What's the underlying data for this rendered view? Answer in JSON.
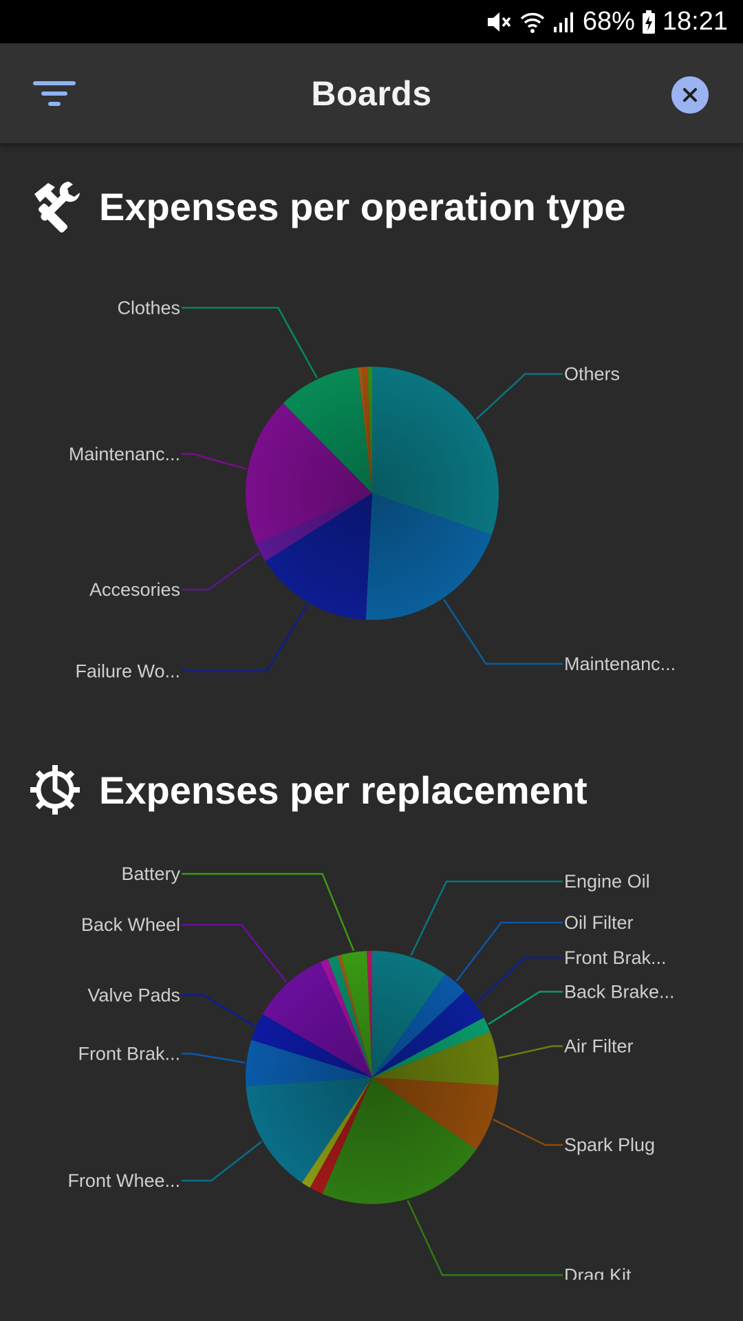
{
  "status_bar": {
    "battery": "68%",
    "time": "18:21"
  },
  "app_bar": {
    "title": "Boards",
    "left_icon": "filter-icon",
    "right_icon": "close-icon",
    "accent": "#9ab4f2"
  },
  "sections": [
    {
      "title": "Expenses per operation type",
      "icon": "tools-icon"
    },
    {
      "title": "Expenses per replacement",
      "icon": "gear-icon"
    }
  ],
  "chart_data": [
    {
      "type": "pie",
      "title": "Expenses per operation type",
      "slices": [
        {
          "label": "Others",
          "value": 30.3,
          "color": "#0a7580",
          "side": "right",
          "show_label": true
        },
        {
          "label": "Maintenanc...",
          "value": 20.5,
          "color": "#0a5f9c",
          "side": "right",
          "show_label": true
        },
        {
          "label": "Failure Wo...",
          "value": 15.2,
          "color": "#0d1c90",
          "side": "left",
          "show_label": true
        },
        {
          "label": "Accesories",
          "value": 2.5,
          "color": "#5a1890",
          "side": "left",
          "show_label": true
        },
        {
          "label": "Maintenanc...",
          "value": 19.1,
          "color": "#7a0e8c",
          "side": "left",
          "show_label": true
        },
        {
          "label": "Clothes",
          "value": 10.6,
          "color": "#078a56",
          "side": "left",
          "show_label": true
        },
        {
          "label": "",
          "value": 0.5,
          "color": "#9a5a12",
          "side": "left",
          "show_label": false
        },
        {
          "label": "",
          "value": 0.7,
          "color": "#a24a10",
          "side": "left",
          "show_label": false
        },
        {
          "label": "",
          "value": 0.6,
          "color": "#3a8a12",
          "side": "left",
          "show_label": false
        }
      ]
    },
    {
      "type": "pie",
      "title": "Expenses per replacement",
      "slices": [
        {
          "label": "Engine Oil",
          "value": 10.0,
          "color": "#0a7580",
          "side": "right",
          "show_label": true
        },
        {
          "label": "Oil Filter",
          "value": 3.3,
          "color": "#0a58a8",
          "side": "right",
          "show_label": true
        },
        {
          "label": "Front Brak...",
          "value": 4.2,
          "color": "#0b1f9a",
          "side": "right",
          "side_note": "",
          "show_label": true
        },
        {
          "label": "Back Brake...",
          "value": 2.0,
          "color": "#0a9a6a",
          "side": "right",
          "show_label": true
        },
        {
          "label": "Air Filter",
          "value": 7.0,
          "color": "#6a7e0c",
          "side": "right",
          "show_label": true
        },
        {
          "label": "Spark Plug",
          "value": 8.8,
          "color": "#8e4a0a",
          "side": "right",
          "show_label": true
        },
        {
          "label": "Drag Kit",
          "value": 22.2,
          "color": "#2f7a12",
          "side": "right",
          "show_label": true
        },
        {
          "label": "",
          "value": 1.8,
          "color": "#a01818",
          "side": "left",
          "show_label": false
        },
        {
          "label": "",
          "value": 1.2,
          "color": "#8a9a12",
          "side": "left",
          "show_label": false
        },
        {
          "label": "Front Whee...",
          "value": 14.8,
          "color": "#0a6e88",
          "side": "left",
          "show_label": true
        },
        {
          "label": "Front Brak...",
          "value": 6.0,
          "color": "#0a5aa8",
          "side": "left",
          "show_label": true
        },
        {
          "label": "Valve Pads",
          "value": 3.6,
          "color": "#0d1aa0",
          "side": "left",
          "show_label": true
        },
        {
          "label": "Back Wheel",
          "value": 10.2,
          "color": "#6a0e9c",
          "side": "left",
          "show_label": true
        },
        {
          "label": "",
          "value": 1.0,
          "color": "#a0129a",
          "side": "left",
          "show_label": false
        },
        {
          "label": "",
          "value": 1.3,
          "color": "#0a8a6a",
          "side": "left",
          "show_label": false
        },
        {
          "label": "",
          "value": 0.5,
          "color": "#9a5a12",
          "side": "left",
          "show_label": false
        },
        {
          "label": "Battery",
          "value": 3.3,
          "color": "#3a9a14",
          "side": "left",
          "show_label": true
        },
        {
          "label": "",
          "value": 0.7,
          "color": "#b0185a",
          "side": "left",
          "show_label": false
        }
      ]
    }
  ]
}
